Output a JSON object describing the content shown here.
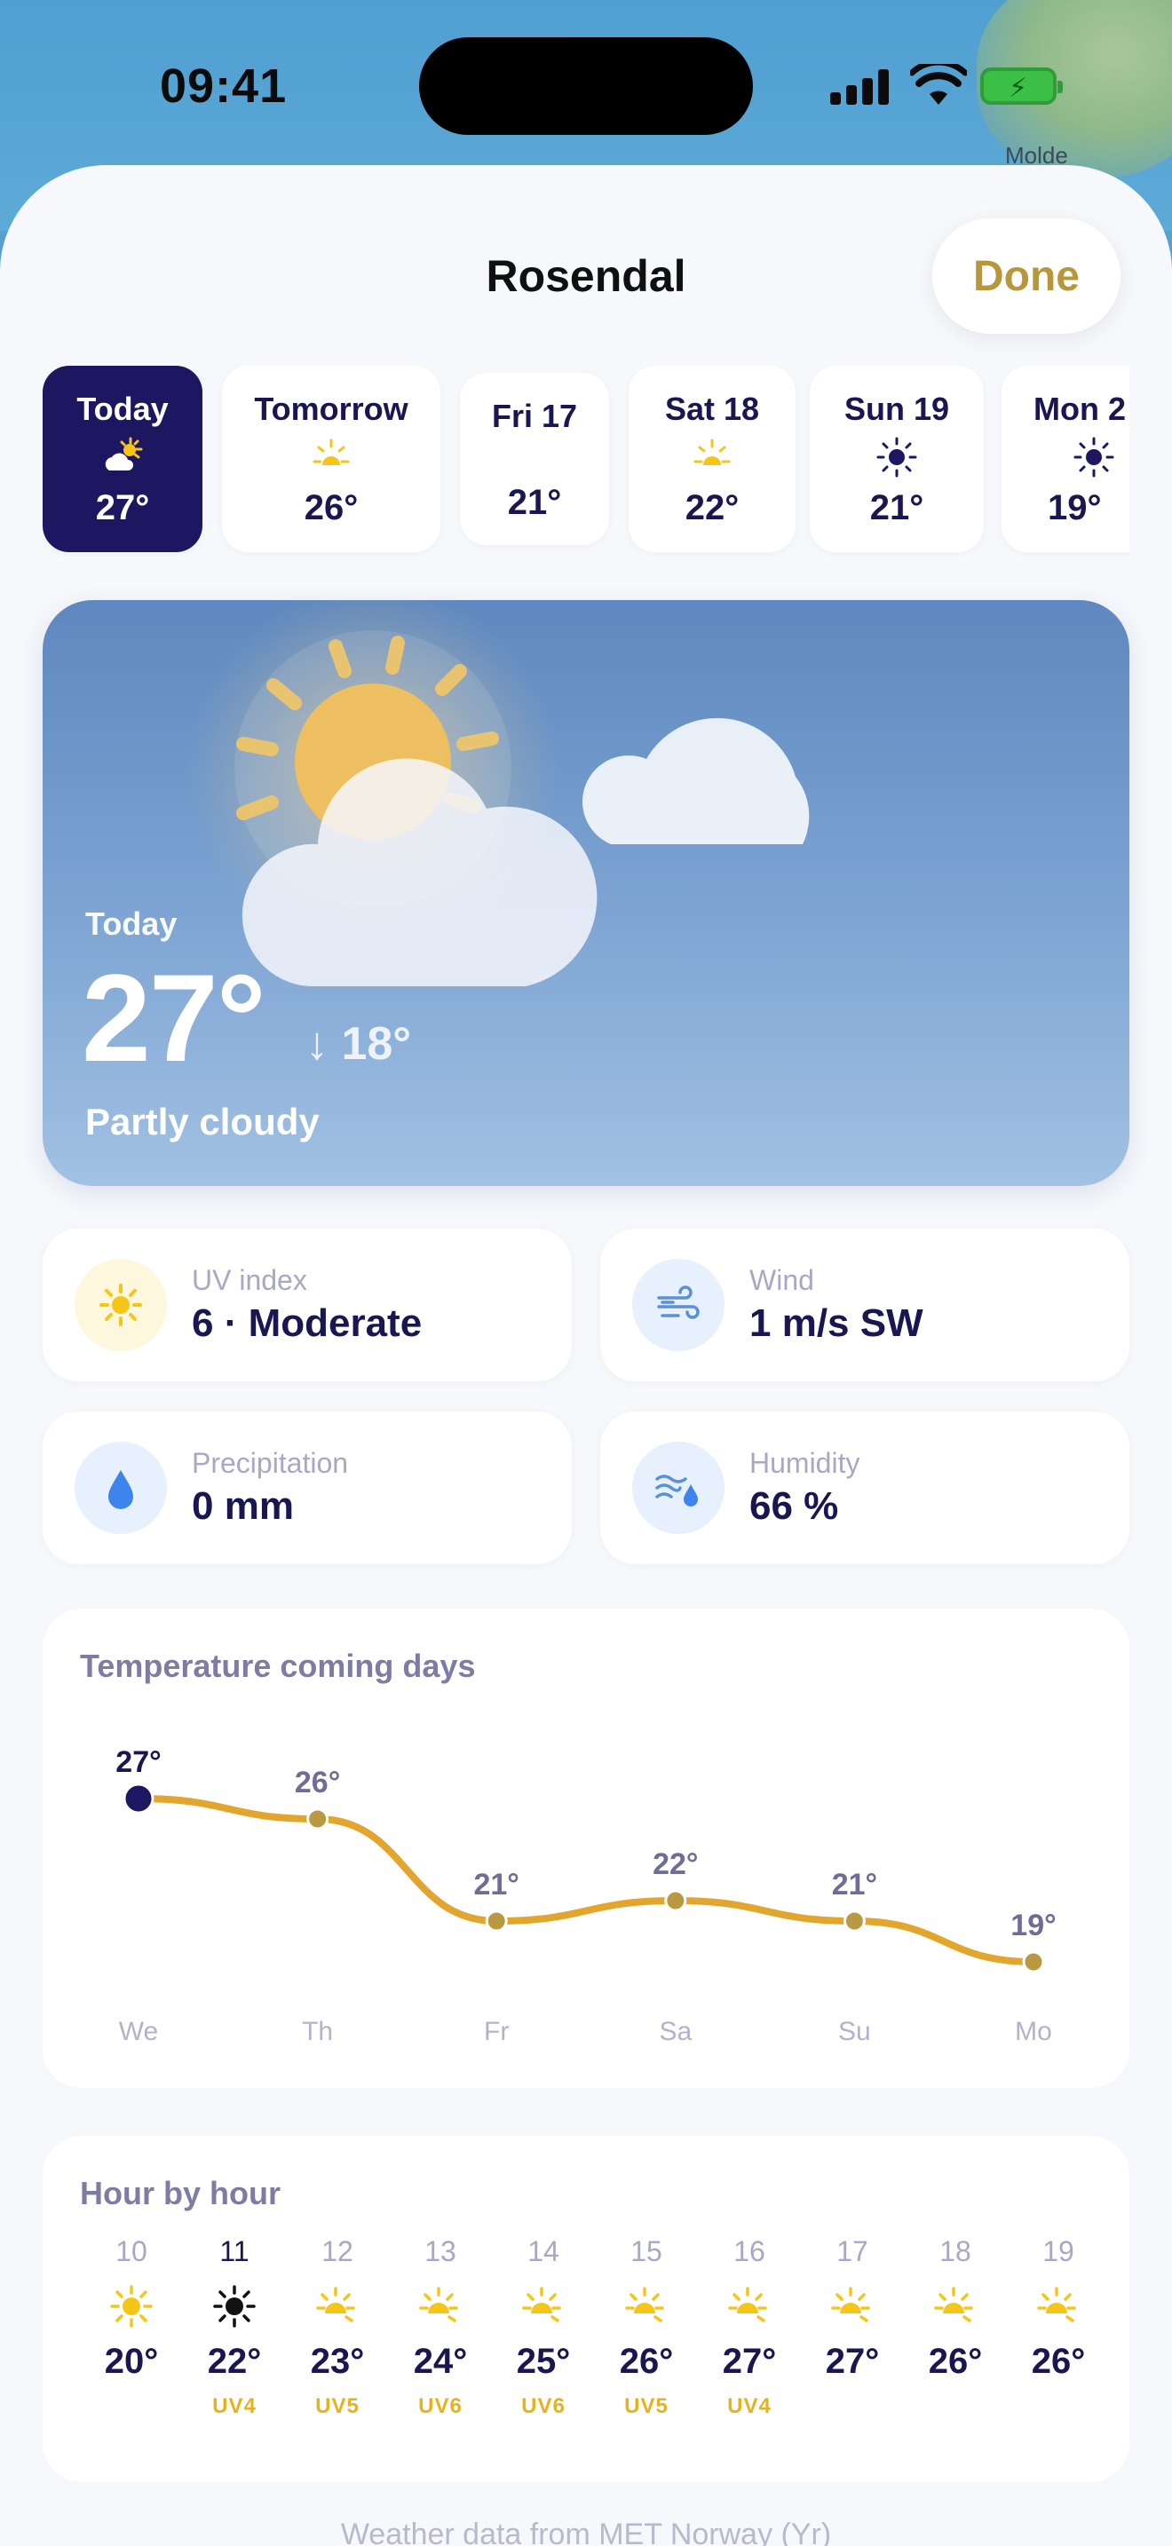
{
  "status_bar": {
    "time": "09:41"
  },
  "map": {
    "label": "Molde"
  },
  "header": {
    "city": "Rosendal",
    "done_label": "Done"
  },
  "days": [
    {
      "label": "Today",
      "temp": "27°",
      "icon": "partly-cloudy-icon",
      "active": true
    },
    {
      "label": "Tomorrow",
      "temp": "26°",
      "icon": "sun-icon"
    },
    {
      "label": "Fri 17",
      "temp": "21°",
      "icon": "none"
    },
    {
      "label": "Sat 18",
      "temp": "22°",
      "icon": "sun-icon"
    },
    {
      "label": "Sun 19",
      "temp": "21°",
      "icon": "clear-sun-dark-icon"
    },
    {
      "label": "Mon 2",
      "temp": "19°",
      "icon": "clear-sun-dark-icon"
    }
  ],
  "hero": {
    "day": "Today",
    "temp": "27°",
    "low": "↓ 18°",
    "condition": "Partly cloudy"
  },
  "stats": {
    "uv": {
      "label": "UV index",
      "value": "6 · Moderate"
    },
    "wind": {
      "label": "Wind",
      "value": "1 m/s SW"
    },
    "precip": {
      "label": "Precipitation",
      "value": "0 mm"
    },
    "humidity": {
      "label": "Humidity",
      "value": "66 %"
    }
  },
  "chart_card": {
    "title": "Temperature coming days"
  },
  "chart_data": {
    "type": "line",
    "categories": [
      "We",
      "Th",
      "Fr",
      "Sa",
      "Su",
      "Mo"
    ],
    "values": [
      27,
      26,
      21,
      22,
      21,
      19
    ],
    "data_labels": [
      "27°",
      "26°",
      "21°",
      "22°",
      "21°",
      "19°"
    ],
    "title": "Temperature coming days",
    "color": "#e2a52d",
    "highlight_color": "#1c1760"
  },
  "hourly": {
    "title": "Hour by hour",
    "hours": [
      {
        "hour": "10",
        "temp": "20°",
        "uv": "",
        "icon": "sun-icon"
      },
      {
        "hour": "11",
        "temp": "22°",
        "uv": "UV4",
        "icon": "sun-dark-icon",
        "now": true
      },
      {
        "hour": "12",
        "temp": "23°",
        "uv": "UV5",
        "icon": "sun-small-icon"
      },
      {
        "hour": "13",
        "temp": "24°",
        "uv": "UV6",
        "icon": "sun-small-icon"
      },
      {
        "hour": "14",
        "temp": "25°",
        "uv": "UV6",
        "icon": "sun-small-icon"
      },
      {
        "hour": "15",
        "temp": "26°",
        "uv": "UV5",
        "icon": "sun-small-icon"
      },
      {
        "hour": "16",
        "temp": "27°",
        "uv": "UV4",
        "icon": "sun-small-icon"
      },
      {
        "hour": "17",
        "temp": "27°",
        "uv": "",
        "icon": "sun-small-icon"
      },
      {
        "hour": "18",
        "temp": "26°",
        "uv": "",
        "icon": "sun-small-icon"
      },
      {
        "hour": "19",
        "temp": "26°",
        "uv": "",
        "icon": "sun-small-icon"
      }
    ]
  },
  "footer": {
    "text": "Weather data from MET Norway (Yr)"
  },
  "colors": {
    "accent": "#1c1760",
    "gold": "#b8973a",
    "sun": "#f5c518"
  }
}
